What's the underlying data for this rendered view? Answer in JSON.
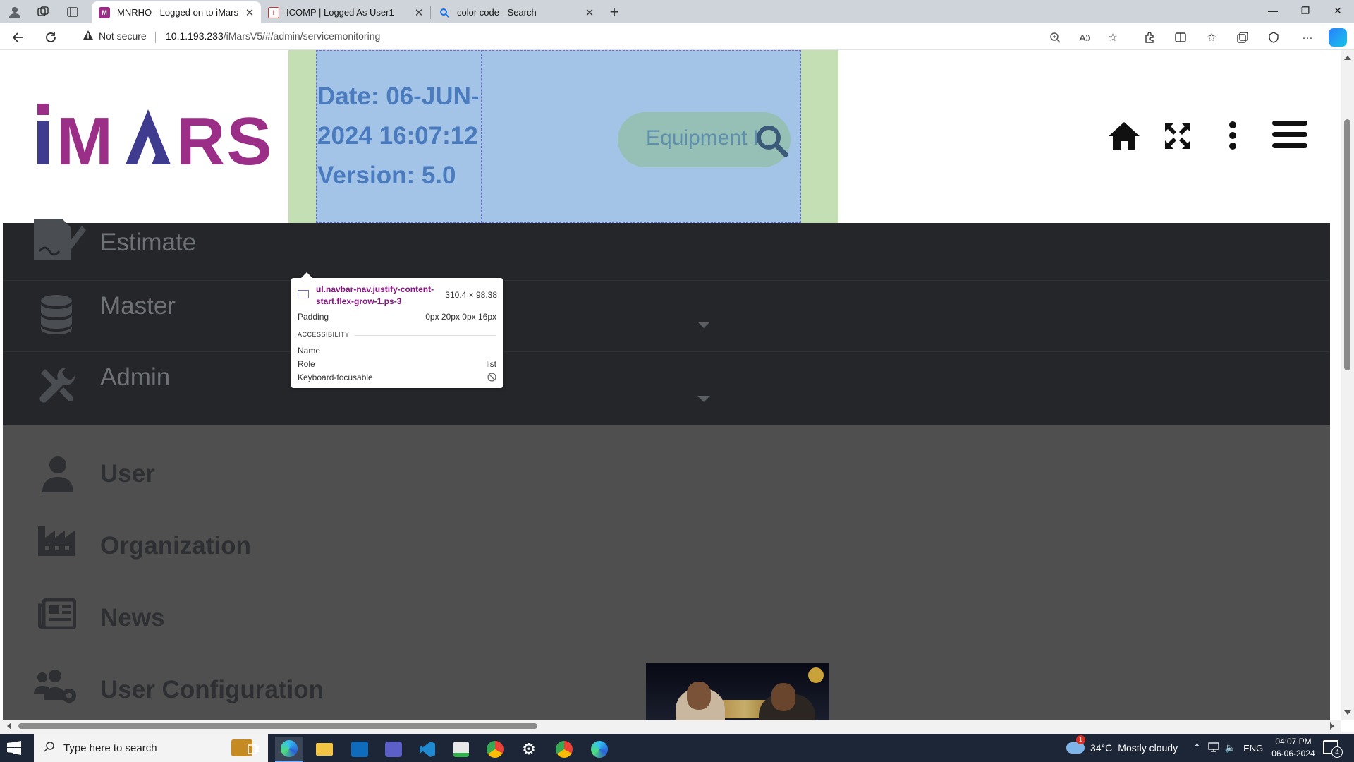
{
  "browser": {
    "tabs": [
      {
        "title": "MNRHO - Logged on to iMars",
        "favicon": "imars-favicon",
        "active": true
      },
      {
        "title": "ICOMP | Logged As User1",
        "favicon": "icomp-favicon",
        "active": false
      },
      {
        "title": "color code - Search",
        "favicon": "search-favicon",
        "active": false
      }
    ],
    "security_label": "Not secure",
    "url_host": "10.1.193.233",
    "url_path": "/iMarsV5/#/admin/servicemonitoring"
  },
  "header": {
    "logo_text": "iMARS",
    "date_line1": "Date: 06-JUN-",
    "date_line2": "2024 16:07:12",
    "version_line": "Version: 5.0",
    "search_placeholder": "Equipment I"
  },
  "devtools_tooltip": {
    "selector": "ul.navbar-nav.justify-content-start.flex-grow-1.ps-3",
    "size": "310.4 × 98.38",
    "padding_label": "Padding",
    "padding_value": "0px 20px 0px 16px",
    "section_title": "ACCESSIBILITY",
    "name_label": "Name",
    "name_value": "",
    "role_label": "Role",
    "role_value": "list",
    "focusable_label": "Keyboard-focusable"
  },
  "sidebar": {
    "main_items": [
      {
        "label": "Estimate",
        "icon": "file-signature-icon",
        "has_caret": false
      },
      {
        "label": "Master",
        "icon": "database-icon",
        "has_caret": true
      },
      {
        "label": "Admin",
        "icon": "tools-icon",
        "has_caret": true
      }
    ],
    "admin_sub_items": [
      {
        "label": "User",
        "icon": "user-icon"
      },
      {
        "label": "Organization",
        "icon": "industry-icon"
      },
      {
        "label": "News",
        "icon": "newspaper-icon"
      },
      {
        "label": "User Configuration",
        "icon": "users-cog-icon"
      }
    ]
  },
  "taskbar": {
    "search_placeholder": "Type here to search",
    "weather_temp": "34°C",
    "weather_desc": "Mostly cloudy",
    "weather_alert": "1",
    "language": "ENG",
    "time": "04:07 PM",
    "date": "06-06-2024",
    "notification_count": "4"
  },
  "colors": {
    "highlight_margin": "#c5dfb4",
    "highlight_content": "#a3c4e6",
    "logo_purple": "#9b2e86",
    "logo_navy": "#3f3b8f",
    "sidebar_dark": "#24262a",
    "sidebar_gray": "#4f4f4f"
  }
}
